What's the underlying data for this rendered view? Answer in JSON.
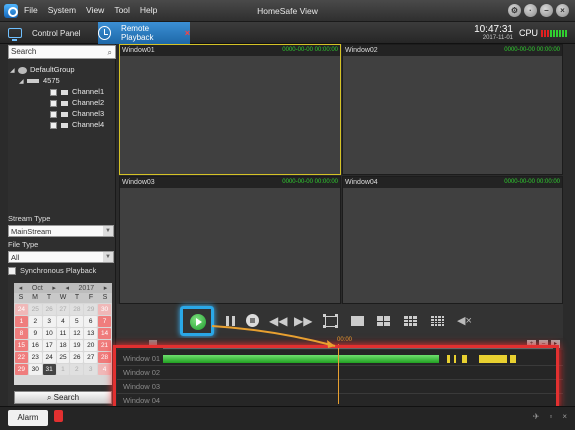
{
  "menu": [
    "File",
    "System",
    "View",
    "Tool",
    "Help"
  ],
  "app_title": "HomeSafe View",
  "tabs": {
    "control_panel": "Control Panel",
    "remote_playback": "Remote Playback"
  },
  "clock": {
    "time": "10:47:31",
    "date": "2017-11-01"
  },
  "cpu_label": "CPU",
  "search": {
    "placeholder": "Search"
  },
  "tree": {
    "group": "DefaultGroup",
    "device": "4575",
    "channels": [
      "Channel1",
      "Channel2",
      "Channel3",
      "Channel4"
    ]
  },
  "stream_type": {
    "label": "Stream Type",
    "value": "MainStream"
  },
  "file_type": {
    "label": "File Type",
    "value": "All"
  },
  "sync_label": "Synchronous Playback",
  "calendar": {
    "month": "Oct",
    "year": "2017",
    "day_names": [
      "S",
      "M",
      "T",
      "W",
      "T",
      "F",
      "S"
    ]
  },
  "search_button": "Search",
  "windows": [
    {
      "name": "Window01",
      "time": "0000-00-00 00:00:00"
    },
    {
      "name": "Window02",
      "time": "0000-00-00 00:00:00"
    },
    {
      "name": "Window03",
      "time": "0000-00-00 00:00:00"
    },
    {
      "name": "Window04",
      "time": "0000-00-00 00:00:00"
    }
  ],
  "timeline": {
    "cursor_time": "00:00",
    "rows": [
      "Window 01",
      "Window 02",
      "Window 03",
      "Window 04"
    ]
  },
  "alarm_tab": "Alarm",
  "colors": {
    "accent": "#2aa8e8",
    "record_green": "#21a021",
    "event_yellow": "#e8d030",
    "highlight_red": "#e23030"
  }
}
